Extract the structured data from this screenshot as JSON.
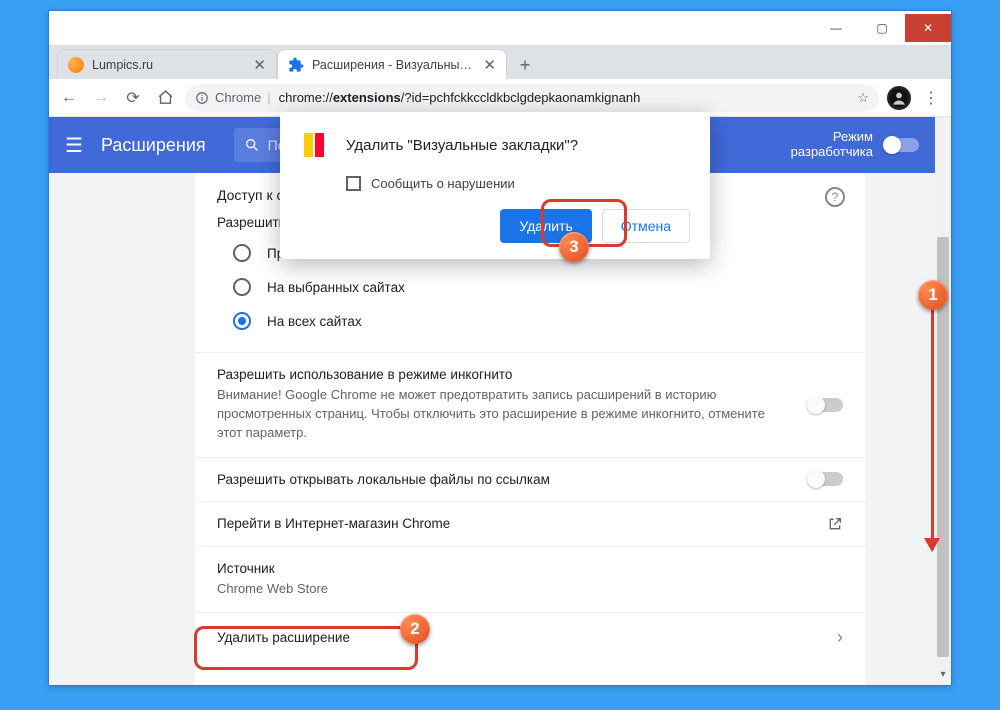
{
  "window": {
    "minimize": "—",
    "maximize": "▢",
    "close": "✕"
  },
  "tabs": [
    {
      "title": "Lumpics.ru",
      "close": "✕"
    },
    {
      "title": "Расширения - Визуальные закл",
      "close": "✕"
    }
  ],
  "newtab": "+",
  "nav": {
    "back": "←",
    "forward": "→",
    "reload": "⟳",
    "home": "⌂"
  },
  "omnibox": {
    "secure_label": "Chrome",
    "url_prefix": "chrome://",
    "url_bold": "extensions",
    "url_rest": "/?id=pchfckkccldkbclgdepkaonamkignanh",
    "star": "☆",
    "menu": "⋮"
  },
  "header": {
    "title": "Расширения",
    "search_placeholder": "Поиск п",
    "dev_mode": "Режим\nразработчика"
  },
  "sections": {
    "access_head": "Доступ к са",
    "access_sub": "Разрешить",
    "radios": [
      "При нажатии",
      "На выбранных сайтах",
      "На всех сайтах"
    ],
    "incognito_title": "Разрешить использование в режиме инкогнито",
    "incognito_desc": "Внимание! Google Chrome не может предотвратить запись расширений в историю просмотренных страниц. Чтобы отключить это расширение в режиме инкогнито, отмените этот параметр.",
    "local_files": "Разрешить открывать локальные файлы по ссылкам",
    "web_store": "Перейти в Интернет-магазин Chrome",
    "source_label": "Источник",
    "source_value": "Chrome Web Store",
    "remove": "Удалить расширение"
  },
  "dialog": {
    "title": "Удалить \"Визуальные закладки\"?",
    "report": "Сообщить о нарушении",
    "confirm": "Удалить",
    "cancel": "Отмена"
  },
  "badges": {
    "b1": "1",
    "b2": "2",
    "b3": "3"
  }
}
